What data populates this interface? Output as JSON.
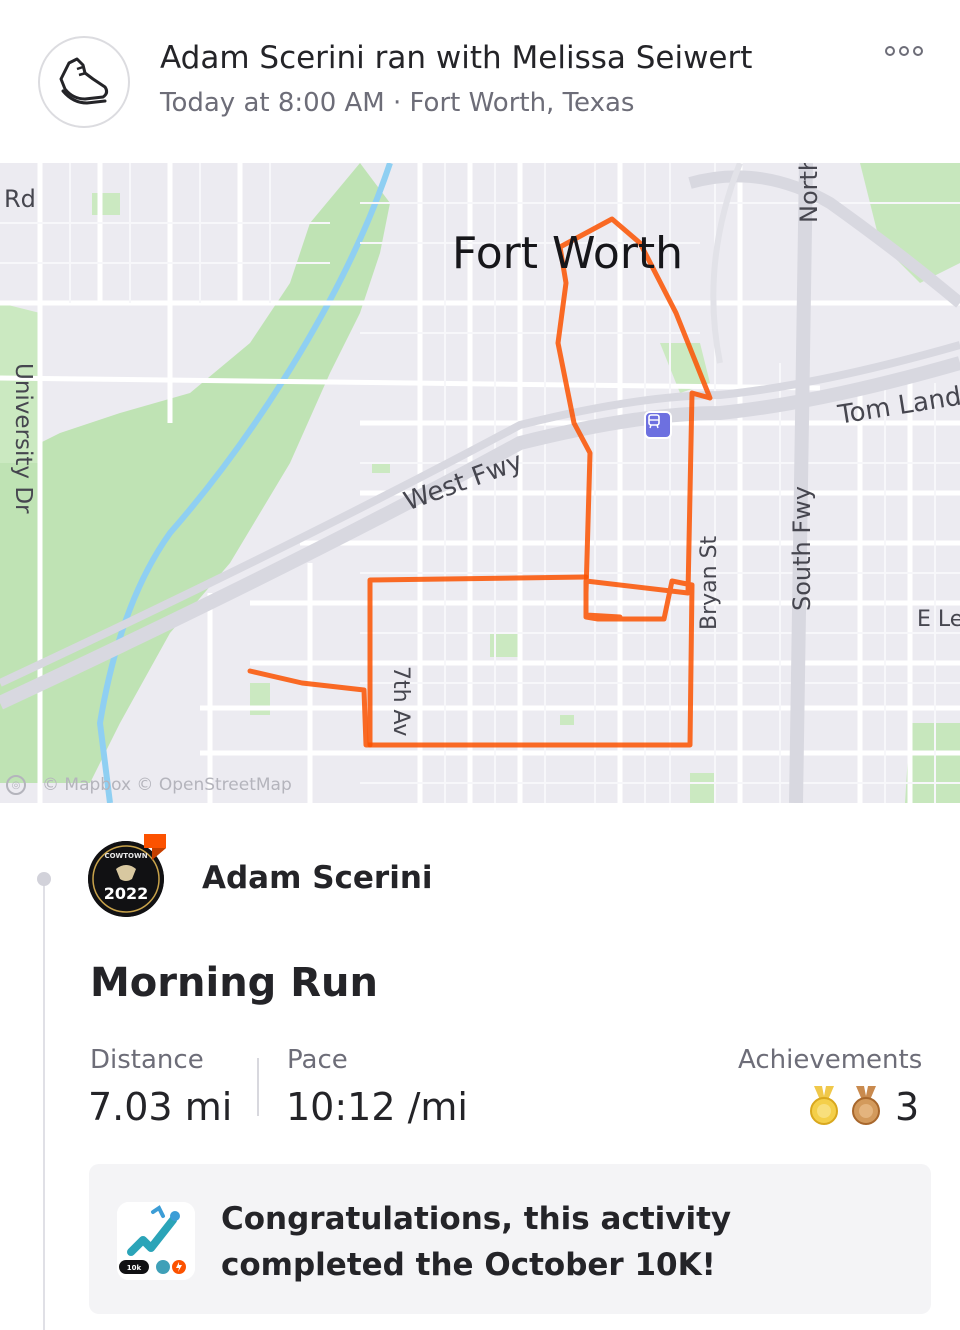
{
  "header": {
    "title": "Adam Scerini ran with Melissa Seiwert",
    "subtitle": "Today at 8:00 AM · Fort Worth, Texas",
    "activity_icon": "running-shoe-icon",
    "more_icon": "more-options-icon"
  },
  "map": {
    "city_label": "Fort Worth",
    "street_labels": {
      "rd": "Rd",
      "university": "University Dr",
      "west_fwy": "West Fwy",
      "tom_landry": "Tom Land",
      "north": "North",
      "south_fwy": "South Fwy",
      "bryan": "Bryan St",
      "seventh_av": "7th Av",
      "e_le": "E Le"
    },
    "attribution": "© Mapbox © OpenStreetMap",
    "route_color": "#fc5200"
  },
  "athlete": {
    "name": "Adam Scerini",
    "avatar_text": "2022",
    "avatar_top_text": "COWTOWN"
  },
  "activity": {
    "title": "Morning Run",
    "distance_label": "Distance",
    "distance_value": "7.03 mi",
    "pace_label": "Pace",
    "pace_value": "10:12 /mi",
    "achievements_label": "Achievements",
    "achievements_count": "3"
  },
  "challenge": {
    "text": "Congratulations, this activity completed the October 10K!",
    "badge_text": "10k"
  }
}
